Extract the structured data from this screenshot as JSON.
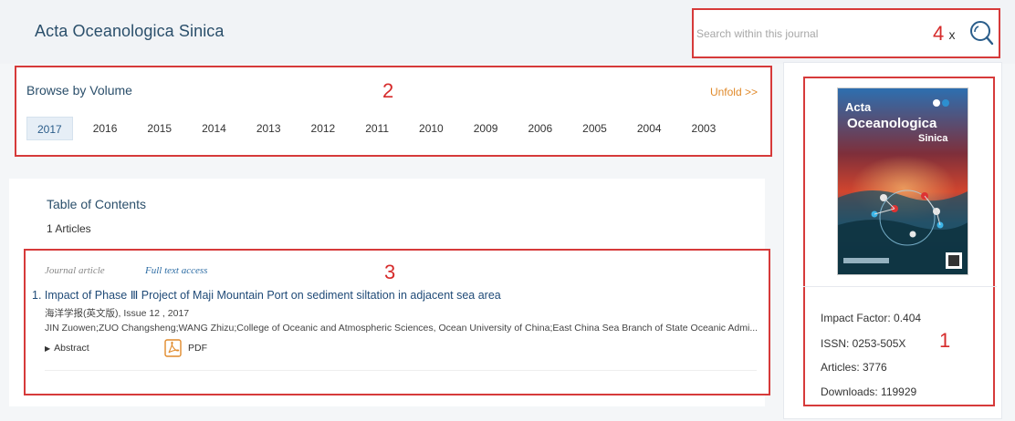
{
  "header": {
    "journal_title": "Acta Oceanologica Sinica",
    "search_placeholder": "Search within this journal",
    "search_marker": "4",
    "clear_label": "x"
  },
  "browse": {
    "title": "Browse by Volume",
    "marker": "2",
    "unfold_label": "Unfold >>",
    "years": [
      "2017",
      "2016",
      "2015",
      "2014",
      "2013",
      "2012",
      "2011",
      "2010",
      "2009",
      "2006",
      "2005",
      "2004",
      "2003"
    ],
    "active_year": "2017"
  },
  "toc": {
    "title": "Table of Contents",
    "count": "1 Articles",
    "article": {
      "type": "Journal article",
      "access": "Full text access",
      "marker": "3",
      "title": "1. Impact of Phase Ⅲ Project of Maji Mountain Port on sediment siltation in adjacent sea area",
      "source": "海洋学报(英文版), Issue 12 , 2017",
      "authors": "JIN Zuowen;ZUO Changsheng;WANG Zhizu;College of Oceanic and Atmospheric Sciences, Ocean University of China;East China Sea Branch of State Oceanic Admi...",
      "abstract_label": "Abstract",
      "pdf_label": "PDF"
    }
  },
  "sidebar": {
    "marker": "1",
    "cover_title_line1": "Acta",
    "cover_title_line2": "Oceanologica",
    "cover_title_line3": "Sinica",
    "impact_factor": "Impact Factor: 0.404",
    "issn": "ISSN: 0253-505X",
    "articles": "Articles: 3776",
    "downloads": "Downloads: 119929"
  },
  "colors": {
    "annotation_red": "#d63a3a",
    "title_blue": "#2b4f6b",
    "link_orange": "#e08a2b"
  }
}
